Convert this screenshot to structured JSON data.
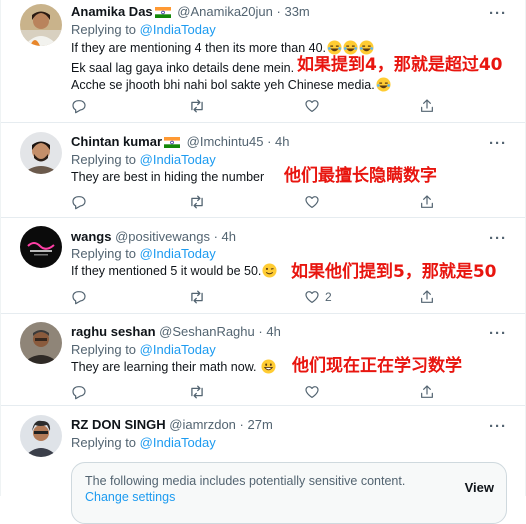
{
  "colors": {
    "link": "#1d9bf0",
    "secondary": "#536471",
    "overlay_red": "#e8150f",
    "divider": "#e6ecf0"
  },
  "more_label": "···",
  "replying_prefix": "Replying to",
  "replying_mention": "@IndiaToday",
  "tweets": [
    {
      "name": "Anamika Das",
      "flag": "india-flag-icon",
      "handle": "@Anamika20jun",
      "separator": "·",
      "time": "33m",
      "lines": [
        "If they are mentioning 4 then its more than 40.",
        "Ek saal lag gaya inko details dene mein.",
        "Acche se jhooth bhi nahi bol sakte yeh Chinese media."
      ],
      "emoji_icons": [
        "laughing-emoji-icon",
        "laughing-emoji-icon",
        "laughing-emoji-icon",
        "laughing-emoji-icon"
      ],
      "overlay": "如果提到4，那就是超过40",
      "likes": ""
    },
    {
      "name": "Chintan kumar",
      "flag": "india-flag-icon",
      "handle": "@Imchintu45",
      "separator": "·",
      "time": "4h",
      "lines": [
        "They are best in hiding the number"
      ],
      "overlay": "他们最擅长隐瞒数字",
      "likes": ""
    },
    {
      "name": "wangs",
      "handle": "@positivewangs",
      "separator": "·",
      "time": "4h",
      "lines": [
        "If they mentioned 5 it would be 50."
      ],
      "emoji_icons": [
        "winking-emoji-icon"
      ],
      "overlay": "如果他们提到5，那就是50",
      "likes": "2"
    },
    {
      "name": "raghu seshan",
      "handle": "@SeshanRaghu",
      "separator": "·",
      "time": "4h",
      "lines": [
        "They are learning their math now."
      ],
      "emoji_icons": [
        "grinning-emoji-icon"
      ],
      "overlay": "他们现在正在学习数学",
      "likes": ""
    },
    {
      "name": "RZ DON SINGH",
      "handle": "@iamrzdon",
      "separator": "·",
      "time": "27m"
    }
  ],
  "media_warning": {
    "text": "The following media includes potentially sensitive content.",
    "link": "Change settings",
    "button": "View"
  }
}
